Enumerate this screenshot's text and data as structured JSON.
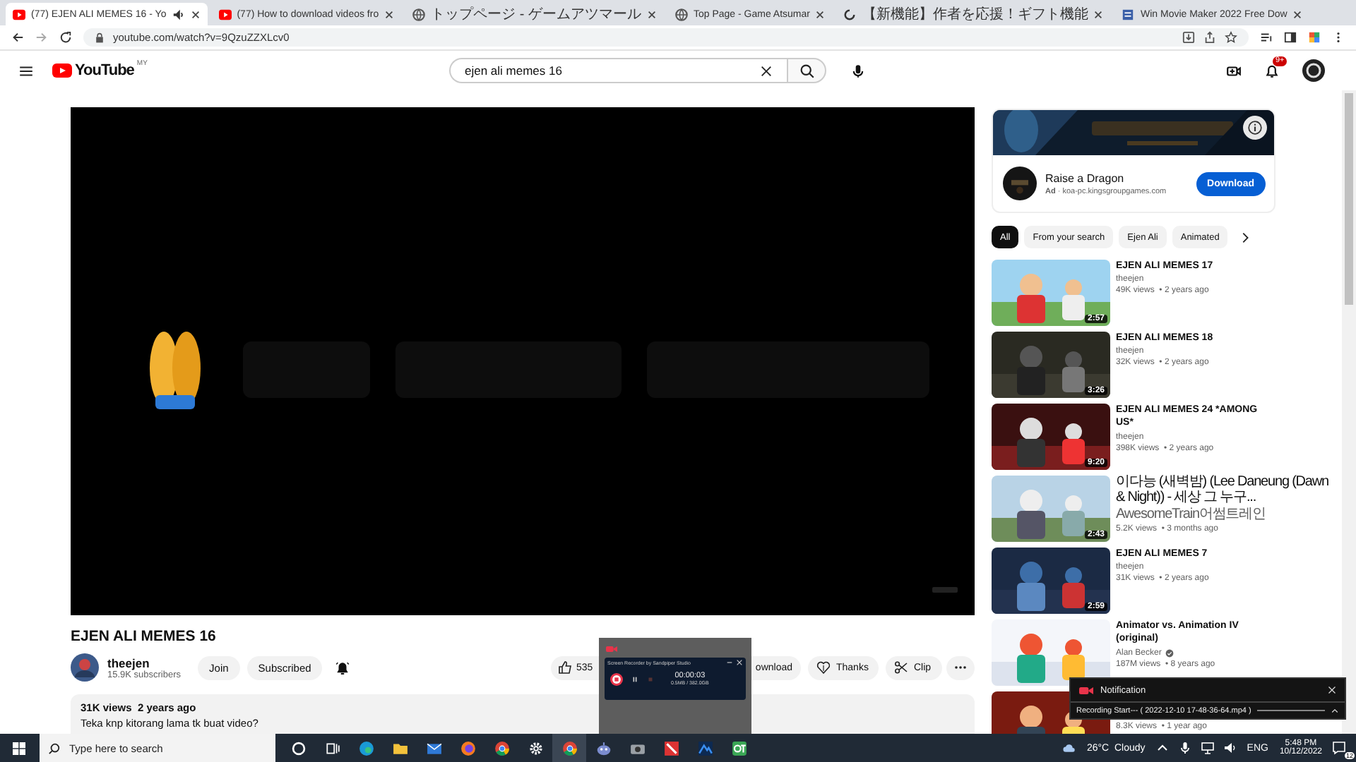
{
  "browser": {
    "tabs": [
      {
        "title": "(77) EJEN ALI MEMES 16 - Yo",
        "kind": "youtube",
        "audio": true,
        "selected": true
      },
      {
        "title": "(77) How to download videos fro",
        "kind": "youtube",
        "audio": false,
        "selected": false
      },
      {
        "title": "トップページ - ゲームアツマール",
        "kind": "globe",
        "audio": false,
        "selected": false
      },
      {
        "title": "Top Page - Game Atsumar",
        "kind": "globe",
        "audio": false,
        "selected": false
      },
      {
        "title": "【新機能】作者を応援！ギフト機能",
        "kind": "loading",
        "audio": false,
        "selected": false
      },
      {
        "title": "Win Movie Maker 2022 Free Dow",
        "kind": "doc",
        "audio": false,
        "selected": false
      }
    ],
    "address": "youtube.com/watch?v=9QzuZZXLcv0"
  },
  "youtube": {
    "logo": "YouTube",
    "region": "MY",
    "search": "ejen ali memes 16",
    "notifications": "9+"
  },
  "video": {
    "kind": "picture",
    "title": "EJEN ALI MEMES 16",
    "channel": "theejen",
    "subscribers": "15.9K subscribers",
    "join": "Join",
    "subscribed": "Subscribed",
    "likes": "535",
    "actions": [
      {
        "kind": "download",
        "label": "ownload"
      },
      {
        "kind": "thanks",
        "label": "Thanks"
      },
      {
        "kind": "clip",
        "label": "Clip"
      }
    ],
    "stats": "31K views  2 years ago",
    "description": "Teka knp kitorang lama tk buat video?"
  },
  "ad": {
    "title": "Raise a Dragon",
    "source": "**Ad** · koa-pc.kingsgroupgames.com",
    "button": "Download"
  },
  "chips": [
    {
      "label": "All",
      "selected": true
    },
    {
      "label": "From your search",
      "selected": false
    },
    {
      "label": "Ejen Ali",
      "selected": false
    },
    {
      "label": "Animated",
      "selected": false
    }
  ],
  "related": [
    {
      "title": "EJEN ALI MEMES 17",
      "channel": "theejen",
      "verified": false,
      "meta": "49K views  • 2 years ago",
      "duration": "2:57"
    },
    {
      "title": "EJEN ALI MEMES 18",
      "channel": "theejen",
      "verified": false,
      "meta": "32K views  • 2 years ago",
      "duration": "3:26"
    },
    {
      "title": "EJEN ALI MEMES 24 *AMONG US*",
      "channel": "theejen",
      "verified": false,
      "meta": "398K views  • 2 years ago",
      "duration": "9:20"
    },
    {
      "title": "이다능 (새벽밤) (Lee Daneung (Dawn & Night)) - 세상 그 누구...",
      "channel": "AwesomeTrain어썸트레인",
      "verified": false,
      "meta": "5.2K views  • 3 months ago",
      "duration": "2:43"
    },
    {
      "title": "EJEN ALI MEMES 7",
      "channel": "theejen",
      "verified": false,
      "meta": "31K views  • 2 years ago",
      "duration": "2:59"
    },
    {
      "title": "Animator vs. Animation IV (original)",
      "channel": "Alan Becker",
      "verified": true,
      "meta": "187M views  • 8 years ago"
    },
    {
      "meta": "8.3K views  • 1 year ago"
    }
  ],
  "recorder": {
    "title": "Screen Recorder by Sandpiper Studio",
    "time": "00:00:03",
    "size": "0.5MB / 382.0GB"
  },
  "notification": {
    "title": "Notification",
    "message": "Recording Start--- ( 2022-12-10 17-48-36-64.mp4 )"
  },
  "taskbar": {
    "search": "Type here to search",
    "apps": [
      {
        "kind": "cortana",
        "active": false
      },
      {
        "kind": "taskview",
        "active": false
      },
      {
        "kind": "edge",
        "active": false
      },
      {
        "kind": "explorer",
        "active": false
      },
      {
        "kind": "mail",
        "active": false
      },
      {
        "kind": "firefox",
        "active": false
      },
      {
        "kind": "chrome",
        "active": false
      },
      {
        "kind": "settings",
        "active": false
      },
      {
        "kind": "chrome",
        "active": true
      },
      {
        "kind": "robot",
        "active": false
      },
      {
        "kind": "camera",
        "active": false
      },
      {
        "kind": "red",
        "active": false
      },
      {
        "kind": "mountain",
        "active": false
      },
      {
        "kind": "ot",
        "active": false
      }
    ],
    "weather": "26°C  Cloudy",
    "language": "ENG",
    "time": "5:48 PM",
    "date": "10/12/2022",
    "badge": "12"
  }
}
